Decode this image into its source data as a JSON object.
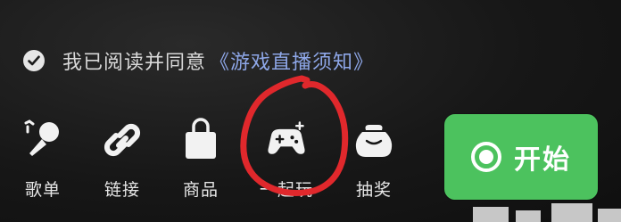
{
  "agreement": {
    "text": "我已阅读并同意",
    "link": "《游戏直播须知》"
  },
  "toolbar": [
    {
      "label": "歌单",
      "icon": "microphone-icon"
    },
    {
      "label": "链接",
      "icon": "link-icon"
    },
    {
      "label": "商品",
      "icon": "shopping-bag-icon"
    },
    {
      "label": "一起玩",
      "icon": "gamepad-plus-icon"
    },
    {
      "label": "抽奖",
      "icon": "gift-pouch-icon"
    }
  ],
  "start_button": {
    "label": "开始",
    "icon": "record-icon"
  },
  "colors": {
    "background": "#151515",
    "link": "#8ea7e8",
    "start_button": "#4cc25e",
    "annotation": "#e0282c"
  }
}
